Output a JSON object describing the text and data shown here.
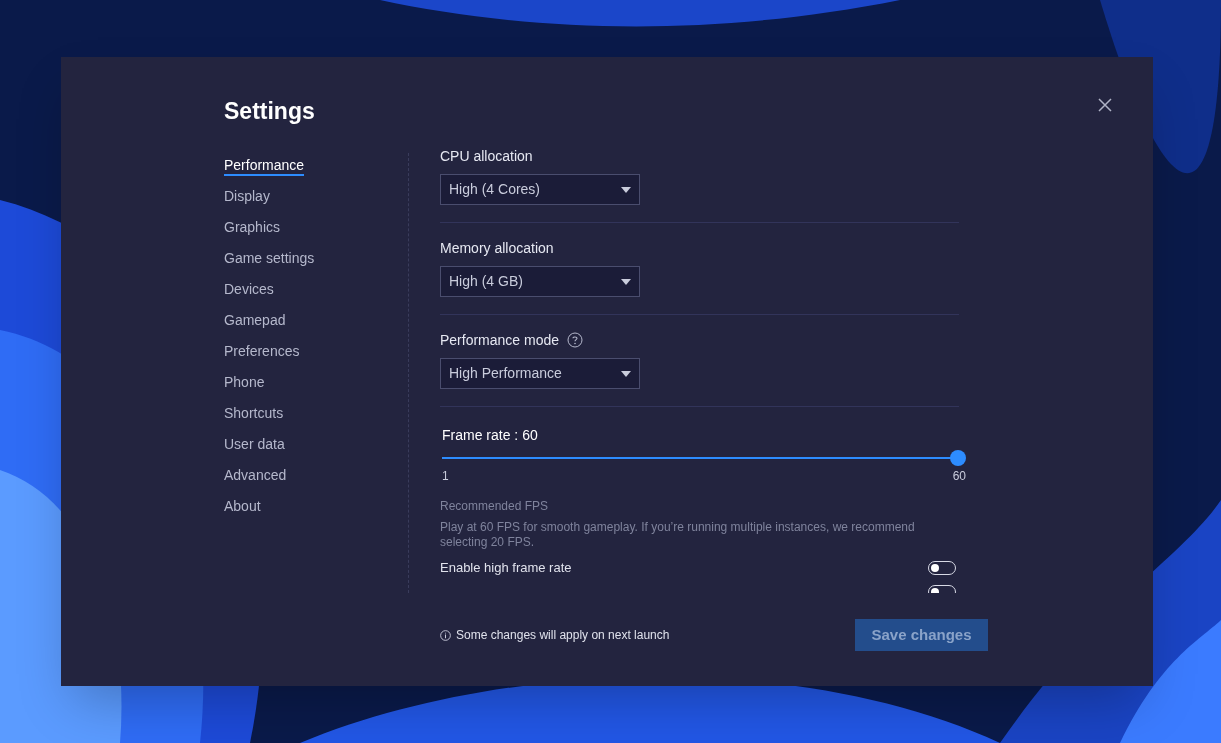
{
  "dialog": {
    "title": "Settings"
  },
  "sidebar": {
    "items": [
      {
        "label": "Performance",
        "selected": true
      },
      {
        "label": "Display",
        "selected": false
      },
      {
        "label": "Graphics",
        "selected": false
      },
      {
        "label": "Game settings",
        "selected": false
      },
      {
        "label": "Devices",
        "selected": false
      },
      {
        "label": "Gamepad",
        "selected": false
      },
      {
        "label": "Preferences",
        "selected": false
      },
      {
        "label": "Phone",
        "selected": false
      },
      {
        "label": "Shortcuts",
        "selected": false
      },
      {
        "label": "User data",
        "selected": false
      },
      {
        "label": "Advanced",
        "selected": false
      },
      {
        "label": "About",
        "selected": false
      }
    ]
  },
  "dropdowns": [
    {
      "label": "CPU allocation",
      "value": "High (4 Cores)",
      "help": false
    },
    {
      "label": "Memory allocation",
      "value": "High (4 GB)",
      "help": false
    },
    {
      "label": "Performance mode",
      "value": "High Performance",
      "help": true
    }
  ],
  "frame_rate": {
    "label": "Frame rate : 60",
    "level": 1,
    "min_label": "1",
    "max_label": "60"
  },
  "recommendation": {
    "title": "Recommended FPS",
    "text": "Play at 60 FPS for smooth gameplay. If you’re running multiple instances, we recommend selecting 20 FPS."
  },
  "toggles": [
    {
      "label": "Enable high frame rate",
      "on": false
    },
    {
      "on": false
    }
  ],
  "footer": {
    "note": "Some changes will apply on next launch",
    "save_button": {
      "label": "Save changes",
      "disabled": true
    }
  }
}
